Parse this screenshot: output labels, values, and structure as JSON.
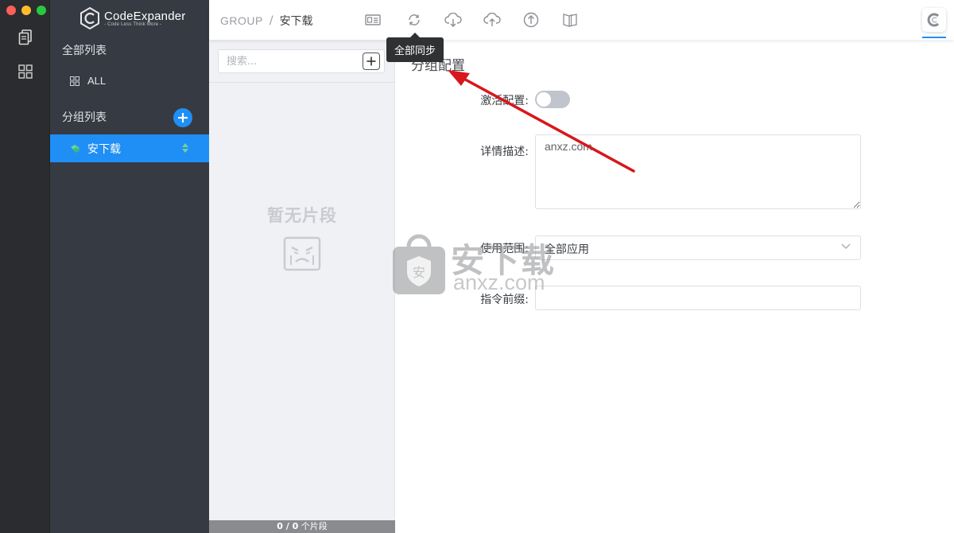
{
  "app": {
    "brand_name": "CodeExpander",
    "brand_slogan": "- Code Less Think More -"
  },
  "sidebar": {
    "all_list_title": "全部列表",
    "all_item_label": "ALL",
    "group_list_title": "分组列表",
    "groups": [
      {
        "label": "安下载",
        "active": true
      }
    ]
  },
  "breadcrumb": {
    "root": "GROUP",
    "separator": "/",
    "current": "安下载"
  },
  "toolbar": {
    "tooltip": "全部同步",
    "icons": [
      "card-icon",
      "sync-icon",
      "cloud-download-icon",
      "cloud-upload-icon",
      "upload-icon",
      "book-icon"
    ]
  },
  "snippet_list": {
    "search_placeholder": "搜索...",
    "empty_text": "暂无片段",
    "footer_count": "0 / 0",
    "footer_unit": "个片段"
  },
  "form": {
    "title": "分组配置",
    "activate_label": "激活配置:",
    "activate_on": false,
    "description_label": "详情描述:",
    "description_value": "anxz.com",
    "scope_label": "使用范围:",
    "scope_value": "全部应用",
    "prefix_label": "指令前缀:",
    "prefix_value": ""
  },
  "watermark": {
    "cn": "安下载",
    "en": "anxz.com"
  },
  "colors": {
    "accent": "#1f8ff5",
    "annotation_arrow": "#d9161c",
    "rail_bg": "#2b2c2f",
    "sidebar_bg": "#363a43"
  }
}
